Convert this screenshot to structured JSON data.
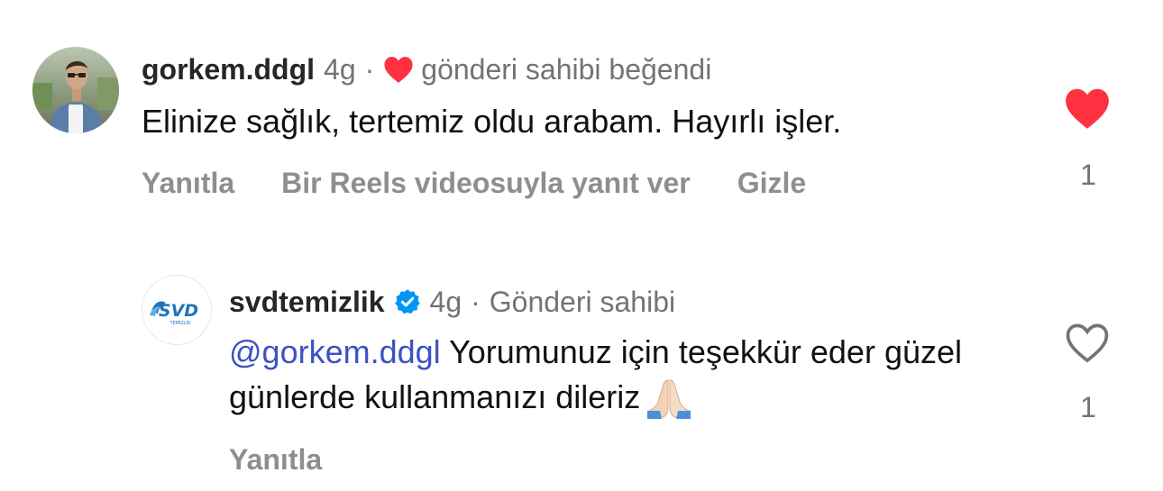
{
  "comments": [
    {
      "username": "gorkem.ddgl",
      "time": "4g",
      "separator": "·",
      "owner_status": "gönderi sahibi beğendi",
      "text": "Elinize sağlık, tertemiz oldu arabam. Hayırlı işler.",
      "actions": [
        "Yanıtla",
        "Bir Reels videosuyla yanıt ver",
        "Gizle"
      ],
      "liked": true,
      "like_count": "1",
      "icons": {
        "inline": "heart-filled-icon",
        "like": "heart-filled-icon"
      }
    },
    {
      "username": "svdtemizlik",
      "verified": true,
      "time": "4g",
      "separator": "·",
      "owner_status": "Gönderi sahibi",
      "mention": "@gorkem.ddgl",
      "text": "Yorumunuz için teşekkür eder güzel günlerde kullanmanızı dileriz",
      "actions": [
        "Yanıtla"
      ],
      "liked": false,
      "like_count": "1",
      "icons": {
        "badge": "verified-badge-icon",
        "emoji": "folded-hands-emoji",
        "like": "heart-outline-icon"
      }
    }
  ],
  "brand_logo": {
    "text": "SVD",
    "subtext": "TEMİZLİK"
  },
  "colors": {
    "username": "#262626",
    "muted": "#737373",
    "action": "#8e8e8e",
    "like_red": "#ff3040",
    "mention_blue": "#3b52c4",
    "verified_blue": "#0095f6",
    "brand_blue": "#1e73be"
  }
}
